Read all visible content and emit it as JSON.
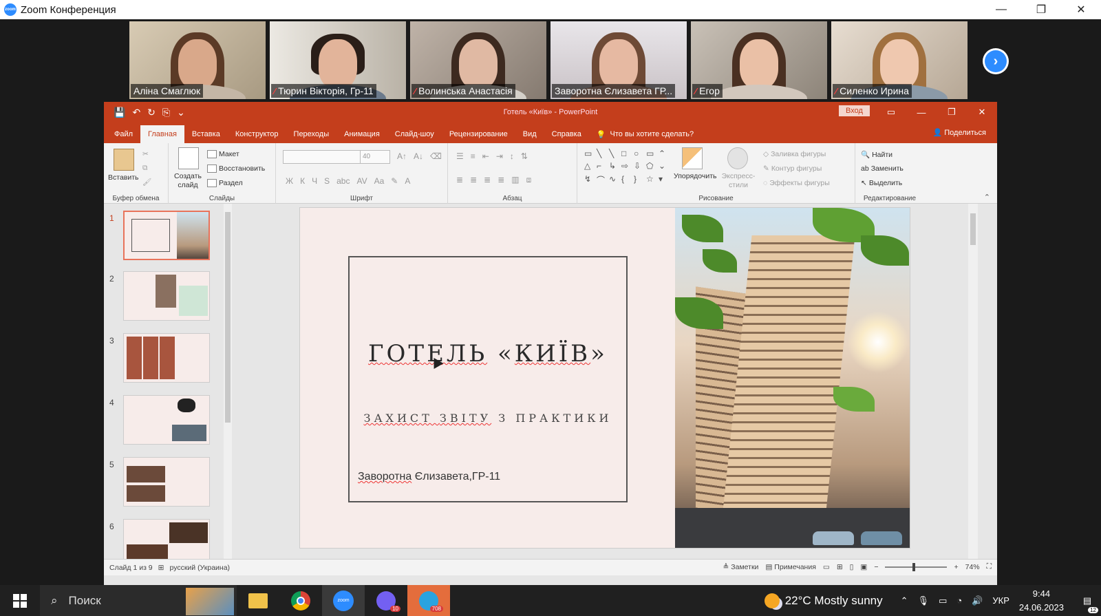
{
  "zoom": {
    "window_title": "Zoom Конференция",
    "logo_text": "zoom",
    "win_min": "—",
    "win_restore": "❐",
    "win_close": "✕",
    "participants": [
      {
        "name": "Аліна Смаглюк",
        "muted": false,
        "active": false
      },
      {
        "name": "Тюрин Вікторія, Гр-11",
        "muted": true,
        "active": false
      },
      {
        "name": "Волинська Анастасія",
        "muted": true,
        "active": false
      },
      {
        "name": "Заворотна Єлизавета ГР...",
        "muted": false,
        "active": true
      },
      {
        "name": "Егор",
        "muted": true,
        "active": false
      },
      {
        "name": "Силенко Ирина",
        "muted": true,
        "active": false
      }
    ],
    "next_arrow": "›"
  },
  "ppt": {
    "title": "Готель «Київ»  -  PowerPoint",
    "login": "Вход",
    "qat": [
      "💾",
      "↶",
      "↻",
      "⎘",
      "⌄"
    ],
    "tabs": [
      "Файл",
      "Главная",
      "Вставка",
      "Конструктор",
      "Переходы",
      "Анимация",
      "Слайд-шоу",
      "Рецензирование",
      "Вид",
      "Справка"
    ],
    "active_tab": "Главная",
    "tell_me": "Что вы хотите сделать?",
    "share": "Поделиться",
    "ribbon": {
      "clipboard": {
        "paste": "Вставить",
        "label": "Буфер обмена"
      },
      "slides": {
        "new_slide": "Создать слайд",
        "layout": "Макет",
        "reset": "Восстановить",
        "section": "Раздел",
        "label": "Слайды"
      },
      "font": {
        "size": "40",
        "bold": "Ж",
        "italic": "К",
        "underline": "Ч",
        "shadow": "S",
        "strike": "abc",
        "spacing": "AV",
        "case": "Aa",
        "color": "A",
        "label": "Шрифт"
      },
      "paragraph": {
        "label": "Абзац"
      },
      "drawing": {
        "arrange": "Упорядочить",
        "quick_styles": "Экспресс-стили",
        "fill": "Заливка фигуры",
        "outline": "Контур фигуры",
        "effects": "Эффекты фигуры",
        "label": "Рисование"
      },
      "editing": {
        "find": "Найти",
        "replace": "Заменить",
        "select": "Выделить",
        "label": "Редактирование"
      }
    },
    "slide": {
      "title_word": "ГОТЕЛЬ",
      "title_open": " «",
      "title_name": "КИЇВ",
      "title_close": "»",
      "subtitle_a": "ЗАХИСТ ",
      "subtitle_b": "ЗВІТУ",
      "subtitle_c": " З ПРАКТИКИ",
      "author_a": "Заворотна",
      "author_b": " Єлизавета,ГР-11"
    },
    "thumbnails": [
      "1",
      "2",
      "3",
      "4",
      "5",
      "6"
    ],
    "status": {
      "slide_of": "Слайд 1 из 9",
      "language": "русский (Украина)",
      "notes": "Заметки",
      "comments": "Примечания",
      "zoom": "74%"
    }
  },
  "taskbar": {
    "search": "Поиск",
    "weather": "22°C  Mostly sunny",
    "lang": "УКР",
    "time": "9:44",
    "date": "24.06.2023",
    "viber_badge": "10",
    "telegram_badge": "708",
    "notif_badge": "12"
  }
}
